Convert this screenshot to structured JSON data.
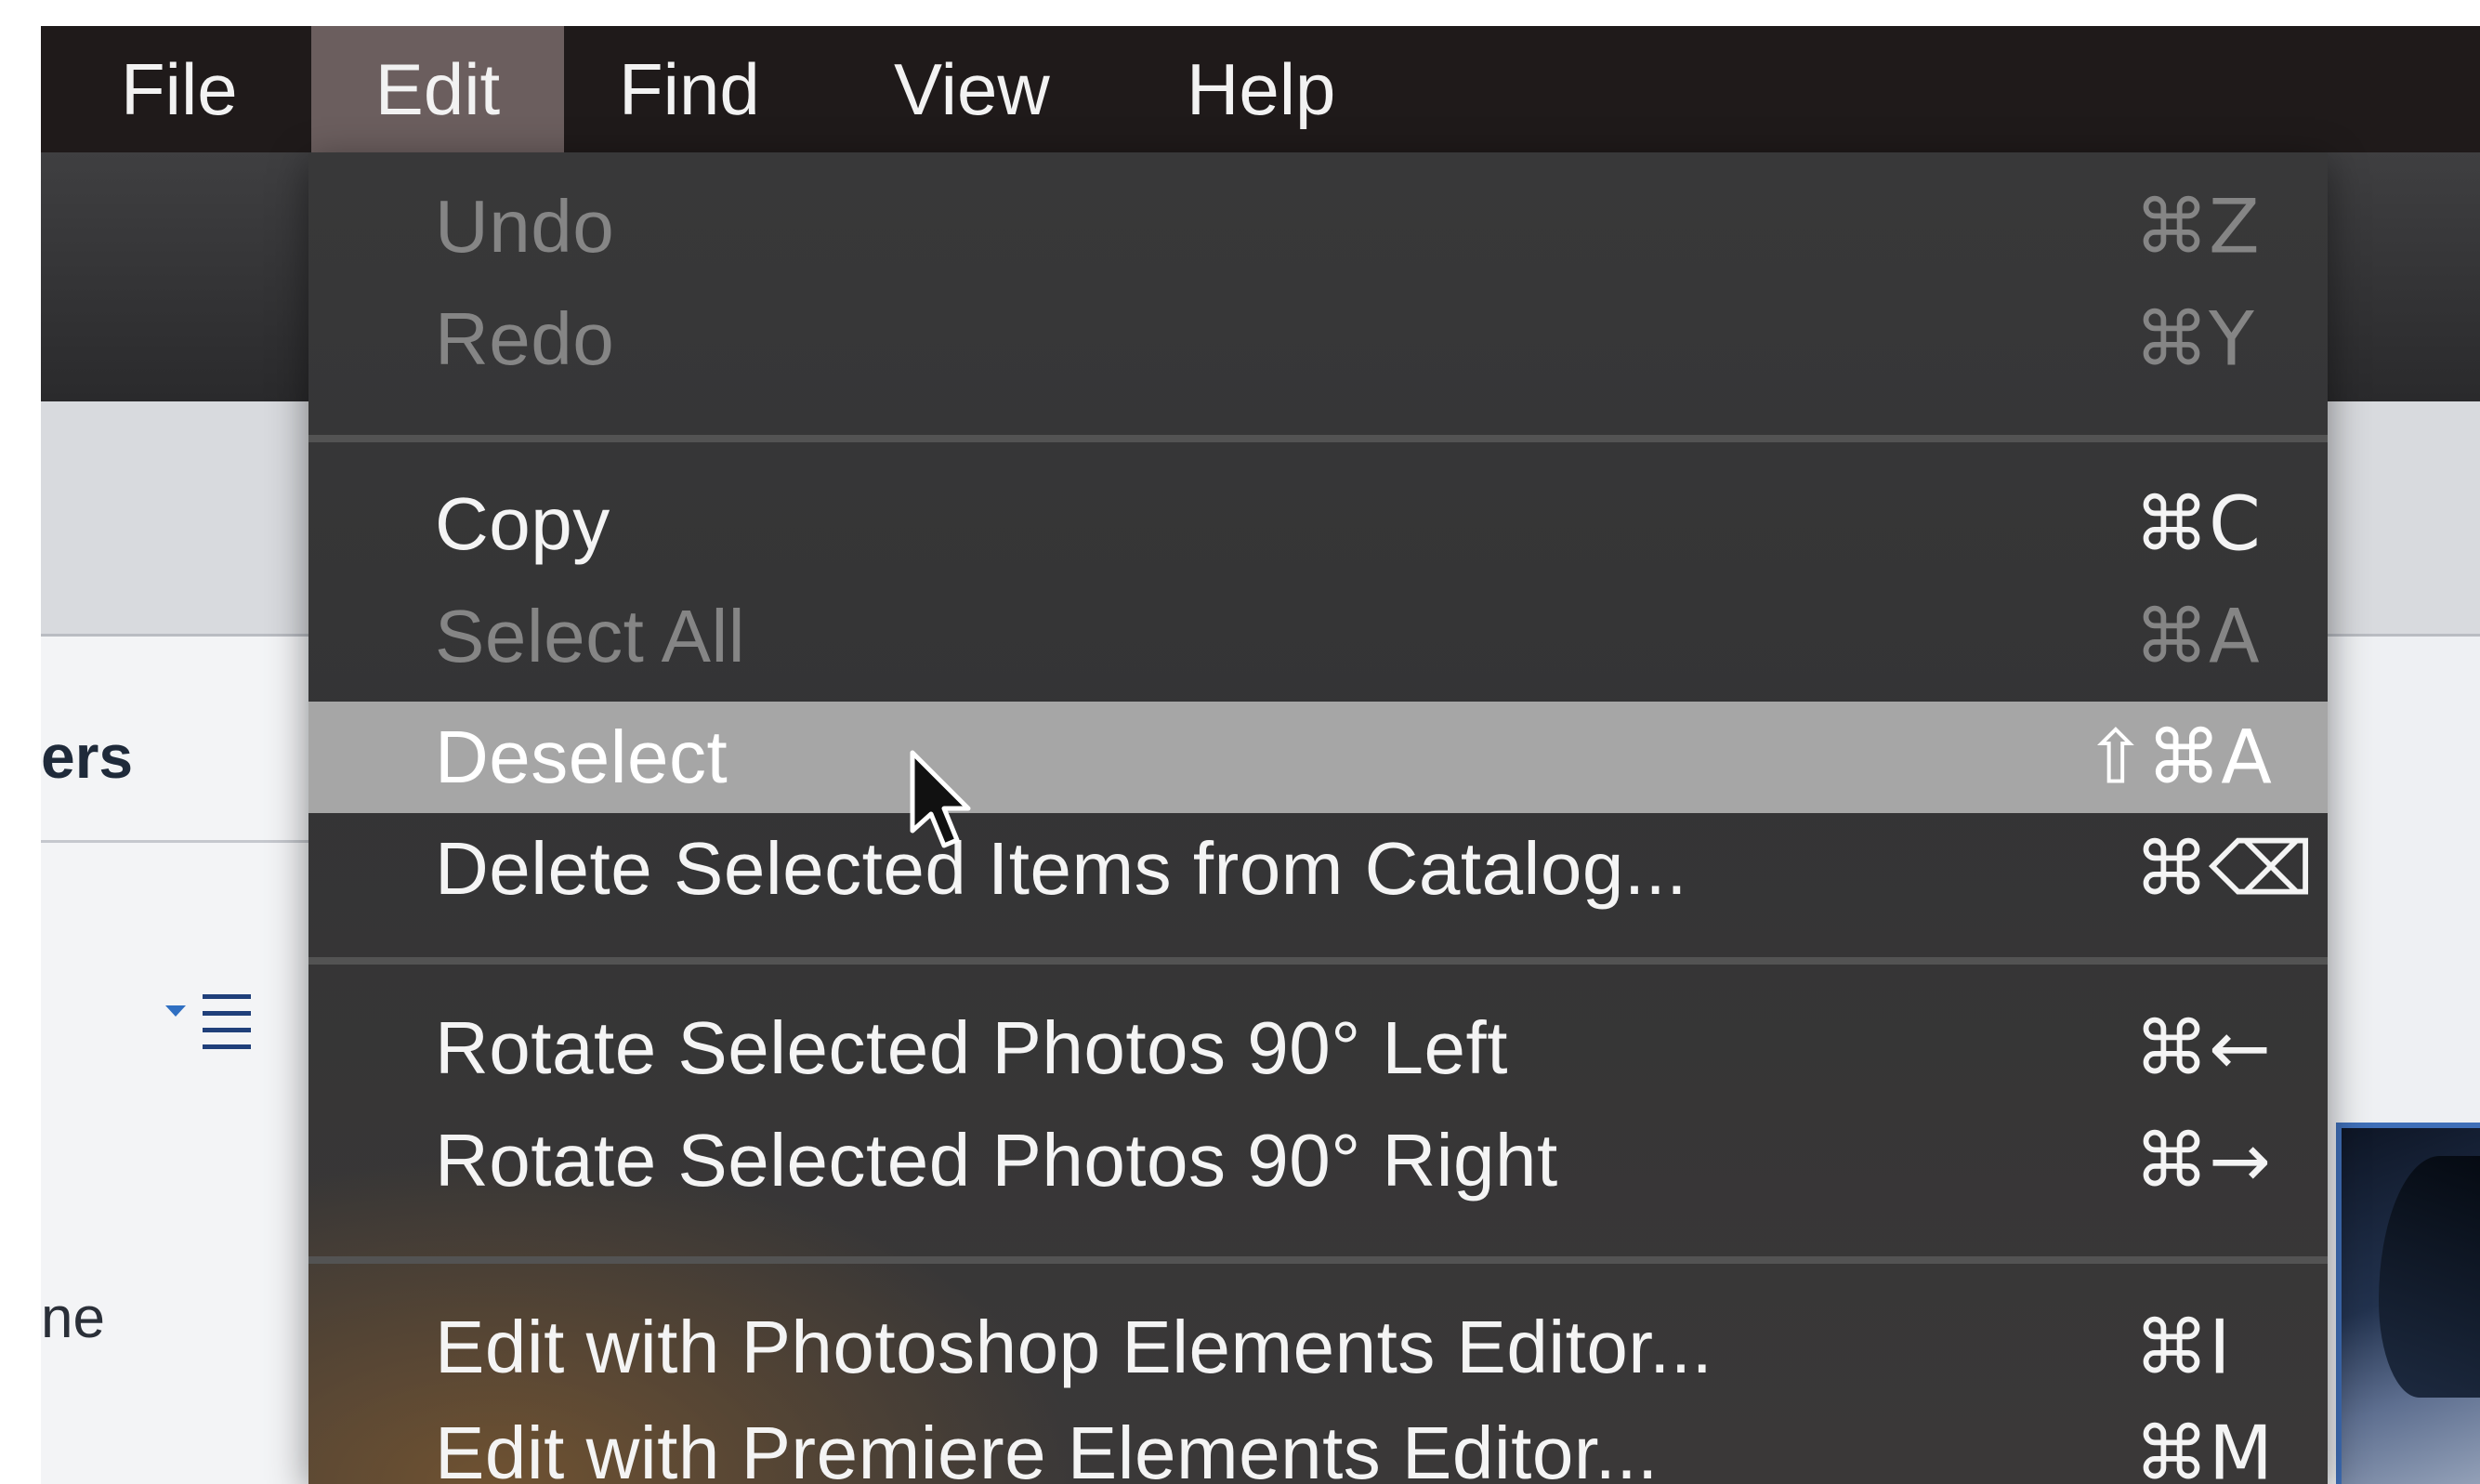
{
  "menubar": {
    "items": [
      {
        "label": "File"
      },
      {
        "label": "Edit"
      },
      {
        "label": "Find"
      },
      {
        "label": "View"
      },
      {
        "label": "Help"
      }
    ],
    "active": "Edit"
  },
  "side_panel": {
    "partial_text_1": "ers",
    "partial_text_2": "ne",
    "sort_icon": "sort-list-icon"
  },
  "edit_menu": {
    "items": [
      {
        "label": "Undo",
        "shortcut": "⌘Z",
        "enabled": false
      },
      {
        "label": "Redo",
        "shortcut": "⌘Y",
        "enabled": false
      },
      {
        "label": "Copy",
        "shortcut": "⌘C",
        "enabled": true
      },
      {
        "label": "Select All",
        "shortcut": "⌘A",
        "enabled": false
      },
      {
        "label": "Deselect",
        "shortcut": "⇧⌘A",
        "enabled": true,
        "highlighted": true
      },
      {
        "label": "Delete Selected Items from Catalog...",
        "shortcut": "⌘⌫",
        "enabled": true
      },
      {
        "label": "Rotate Selected Photos 90° Left",
        "shortcut": "⌘←",
        "enabled": true
      },
      {
        "label": "Rotate Selected Photos 90° Right",
        "shortcut": "⌘→",
        "enabled": true
      },
      {
        "label": "Edit with Photoshop Elements Editor...",
        "shortcut": "⌘I",
        "enabled": true
      },
      {
        "label": "Edit with Premiere Elements Editor...",
        "shortcut": "⌘M",
        "enabled": true
      }
    ]
  },
  "colors": {
    "menubar_bg": "#1f1a1a",
    "active_menu_bg": "#6b5e5e",
    "menu_bg": "#373738",
    "highlight_bg": "#a6a6a6",
    "disabled_text": "#858585",
    "selection_border": "#3f6fb8"
  },
  "cursor": "arrow-pointer-icon"
}
